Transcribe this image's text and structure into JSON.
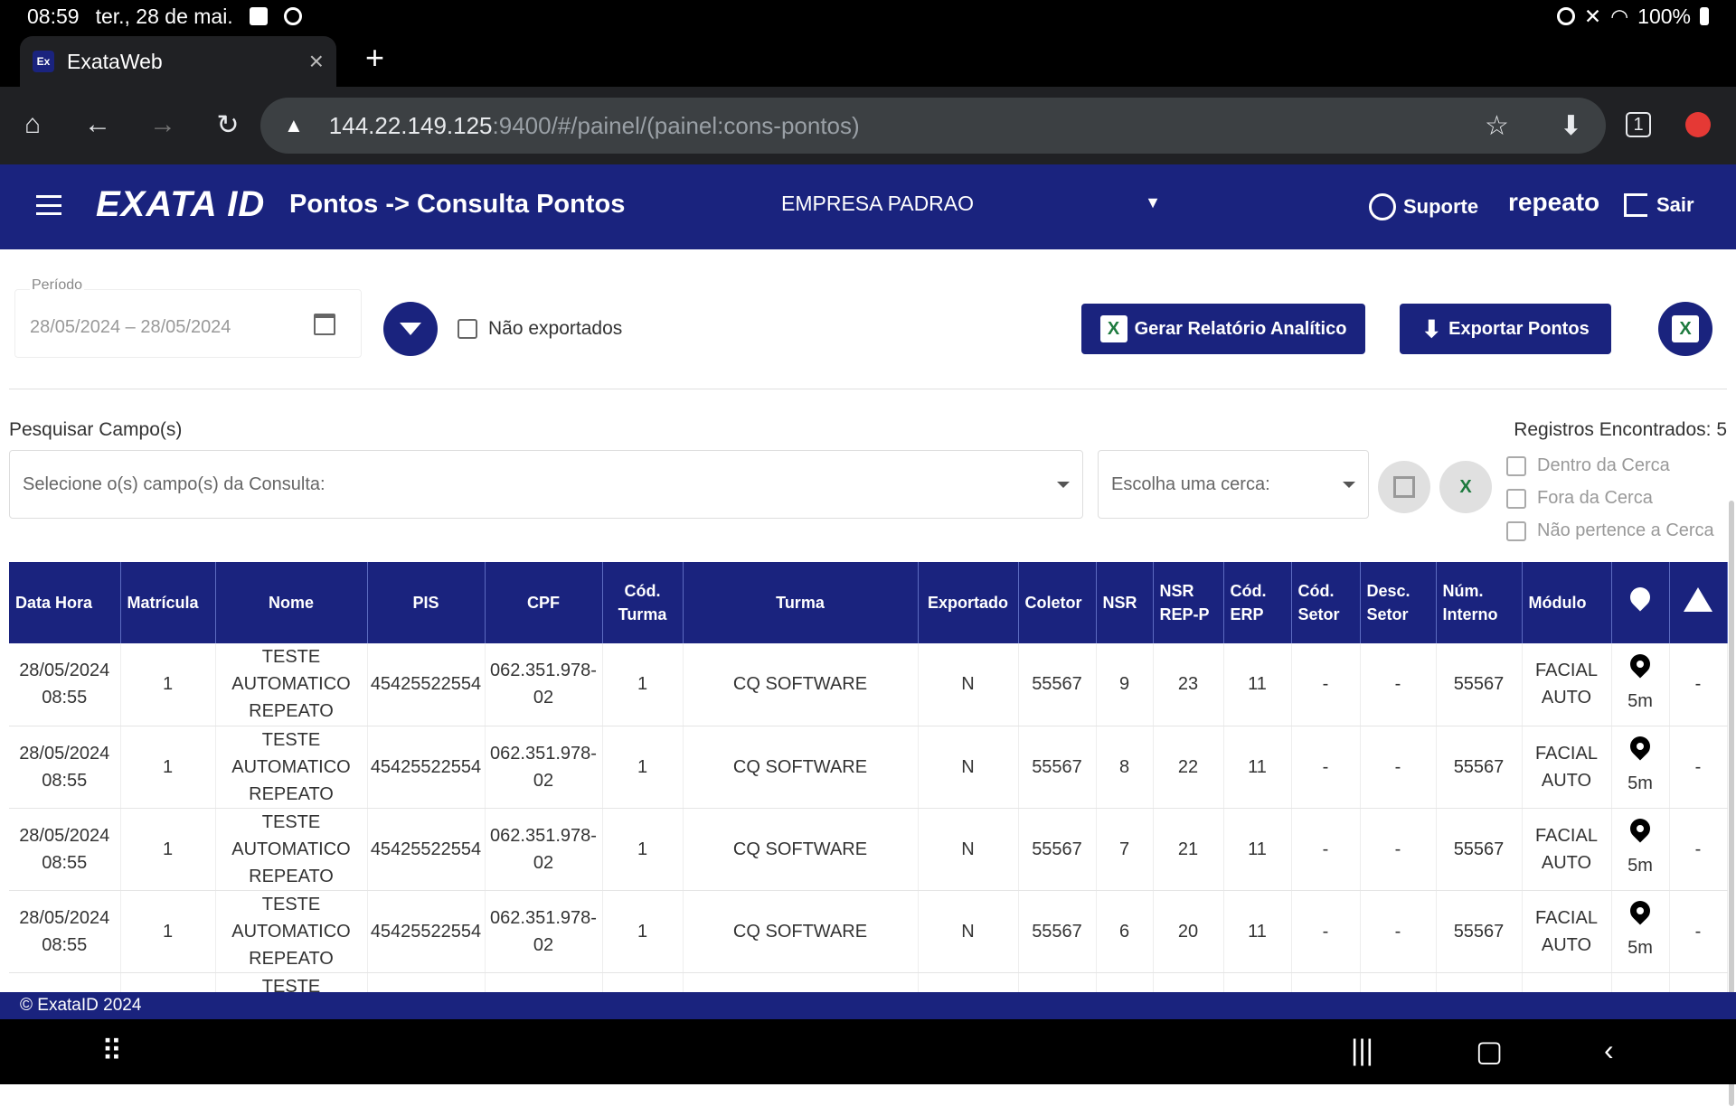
{
  "status": {
    "time": "08:59",
    "date": "ter., 28 de mai.",
    "battery": "100%"
  },
  "browser": {
    "tab_title": "ExataWeb",
    "favicon_text": "Ex",
    "url_host": "144.22.149.125",
    "url_path": ":9400/#/painel/(painel:cons-pontos)"
  },
  "appbar": {
    "logo": "EXATA ID",
    "title": "Pontos -> Consulta Pontos",
    "company": "EMPRESA PADRAO",
    "support": "Suporte",
    "user": "repeato",
    "logout": "Sair",
    "brand_color": "#1a237e"
  },
  "filters": {
    "period_label": "Período",
    "period_value": "28/05/2024 – 28/05/2024",
    "not_exported": "Não exportados",
    "report_btn": "Gerar Relatório Analítico",
    "export_btn": "Exportar Pontos",
    "search_label": "Pesquisar Campo(s)",
    "found": "Registros Encontrados: 5",
    "field_placeholder": "Selecione o(s) campo(s) da Consulta:",
    "fence_placeholder": "Escolha uma cerca:",
    "fence_opts": [
      "Dentro da Cerca",
      "Fora da Cerca",
      "Não pertence a Cerca"
    ]
  },
  "table": {
    "headers": [
      "Data Hora",
      "Matrícula",
      "Nome",
      "PIS",
      "CPF",
      "Cód. Turma",
      "Turma",
      "Exportado",
      "Coletor",
      "NSR",
      "NSR REP-P",
      "Cód. ERP",
      "Cód. Setor",
      "Desc. Setor",
      "Núm. Interno",
      "Módulo"
    ],
    "rows": [
      {
        "data": "28/05/2024 08:55",
        "mat": "1",
        "nome": "TESTE AUTOMATICO REPEATO",
        "pis": "45425522554",
        "cpf": "062.351.978-02",
        "codturma": "1",
        "turma": "CQ SOFTWARE",
        "exp": "N",
        "coletor": "55567",
        "nsr": "9",
        "nsrrep": "23",
        "erp": "11",
        "codsetor": "-",
        "descsetor": "-",
        "interno": "55567",
        "modulo": "FACIAL AUTO",
        "dist": "5m",
        "alert": "-"
      },
      {
        "data": "28/05/2024 08:55",
        "mat": "1",
        "nome": "TESTE AUTOMATICO REPEATO",
        "pis": "45425522554",
        "cpf": "062.351.978-02",
        "codturma": "1",
        "turma": "CQ SOFTWARE",
        "exp": "N",
        "coletor": "55567",
        "nsr": "8",
        "nsrrep": "22",
        "erp": "11",
        "codsetor": "-",
        "descsetor": "-",
        "interno": "55567",
        "modulo": "FACIAL AUTO",
        "dist": "5m",
        "alert": "-"
      },
      {
        "data": "28/05/2024 08:55",
        "mat": "1",
        "nome": "TESTE AUTOMATICO REPEATO",
        "pis": "45425522554",
        "cpf": "062.351.978-02",
        "codturma": "1",
        "turma": "CQ SOFTWARE",
        "exp": "N",
        "coletor": "55567",
        "nsr": "7",
        "nsrrep": "21",
        "erp": "11",
        "codsetor": "-",
        "descsetor": "-",
        "interno": "55567",
        "modulo": "FACIAL AUTO",
        "dist": "5m",
        "alert": "-"
      },
      {
        "data": "28/05/2024 08:55",
        "mat": "1",
        "nome": "TESTE AUTOMATICO REPEATO",
        "pis": "45425522554",
        "cpf": "062.351.978-02",
        "codturma": "1",
        "turma": "CQ SOFTWARE",
        "exp": "N",
        "coletor": "55567",
        "nsr": "6",
        "nsrrep": "20",
        "erp": "11",
        "codsetor": "-",
        "descsetor": "-",
        "interno": "55567",
        "modulo": "FACIAL AUTO",
        "dist": "5m",
        "alert": "-"
      },
      {
        "data": "",
        "mat": "",
        "nome": "TESTE",
        "pis": "",
        "cpf": "",
        "codturma": "",
        "turma": "",
        "exp": "",
        "coletor": "",
        "nsr": "",
        "nsrrep": "",
        "erp": "",
        "codsetor": "",
        "descsetor": "",
        "interno": "",
        "modulo": "",
        "dist": "",
        "alert": ""
      }
    ]
  },
  "footer": "© ExataID 2024"
}
